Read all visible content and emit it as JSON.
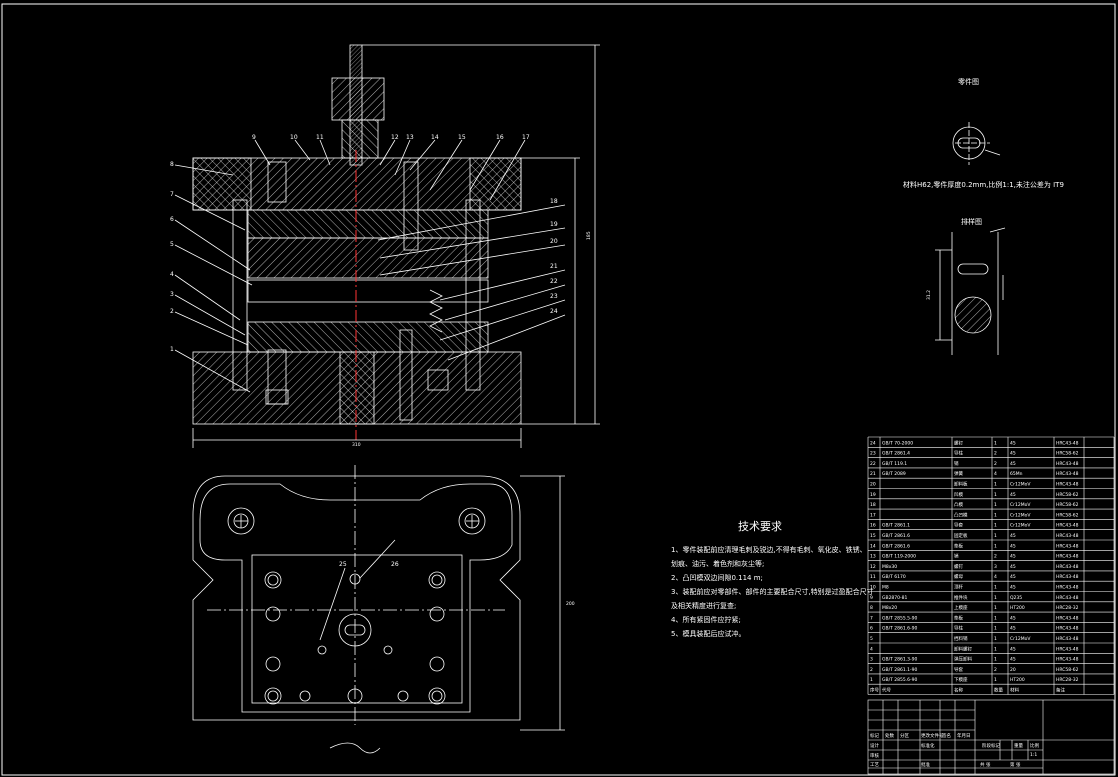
{
  "drawing": {
    "section_view": {
      "part_numbers_left": [
        "8",
        "7",
        "6",
        "5",
        "4",
        "3",
        "2",
        "1"
      ],
      "part_numbers_top": [
        "9",
        "10",
        "11",
        "12",
        "13",
        "14",
        "15",
        "16",
        "17"
      ],
      "part_numbers_right": [
        "18",
        "19",
        "20",
        "21",
        "22",
        "23",
        "24"
      ],
      "height_dim": "185",
      "width_dim": "310"
    },
    "plan_view": {
      "labels": [
        "25",
        "26"
      ],
      "height_dim": "200"
    },
    "workpiece": {
      "title": "零件图",
      "note": "材料H62,零件厚度0.2mm,比例1:1,未注公差为 IT9"
    },
    "strip": {
      "title": "排样图",
      "dim": "31.2"
    },
    "tech_req": {
      "title": "技术要求",
      "lines": [
        "1、零件装配前应清理毛刺及锐边,不得有毛刺、氧化皮、铁锈、",
        "   划痕、油污、着色剂和灰尘等;",
        "2、凸凹模双边间隙0.114 m;",
        "3、装配前应对零部件、部件的主要配合尺寸,特别是过盈配合尺寸",
        "   及相关精度进行复查;",
        "4、所有紧固件应拧紧;",
        "5、模具装配后应试冲。"
      ]
    },
    "bom": [
      {
        "no": "24",
        "code": "GB/T 70-2000",
        "name": "螺钉",
        "qty": "1",
        "mat": "45",
        "note": "HRC43-48"
      },
      {
        "no": "23",
        "code": "GB/T 2861.4",
        "name": "导柱",
        "qty": "2",
        "mat": "45",
        "note": "HRC58-62"
      },
      {
        "no": "22",
        "code": "GB/T 119.1",
        "name": "销",
        "qty": "2",
        "mat": "45",
        "note": "HRC43-48"
      },
      {
        "no": "21",
        "code": "GB/T 2089",
        "name": "弹簧",
        "qty": "4",
        "mat": "65Mn",
        "note": "HRC43-48"
      },
      {
        "no": "20",
        "code": "",
        "name": "卸料板",
        "qty": "1",
        "mat": "Cr12MoV",
        "note": "HRC43-48"
      },
      {
        "no": "19",
        "code": "",
        "name": "凹模",
        "qty": "1",
        "mat": "45",
        "note": "HRC58-62"
      },
      {
        "no": "18",
        "code": "",
        "name": "凸模",
        "qty": "1",
        "mat": "Cr12MoV",
        "note": "HRC58-62"
      },
      {
        "no": "17",
        "code": "",
        "name": "凸凹模",
        "qty": "1",
        "mat": "Cr12MoV",
        "note": "HRC58-62"
      },
      {
        "no": "16",
        "code": "GB/T 2861.1",
        "name": "导套",
        "qty": "1",
        "mat": "Cr12MoV",
        "note": "HRC43-48"
      },
      {
        "no": "15",
        "code": "GB/T 2861.6",
        "name": "固定板",
        "qty": "1",
        "mat": "45",
        "note": "HRC43-48"
      },
      {
        "no": "14",
        "code": "GB/T 2861.6",
        "name": "垫板",
        "qty": "1",
        "mat": "45",
        "note": "HRC43-48"
      },
      {
        "no": "13",
        "code": "GB/T 119-2000",
        "name": "销",
        "qty": "2",
        "mat": "45",
        "note": "HRC43-48"
      },
      {
        "no": "12",
        "code": "M8x30",
        "name": "螺钉",
        "qty": "3",
        "mat": "45",
        "note": "HRC43-48"
      },
      {
        "no": "11",
        "code": "GB/T 6170",
        "name": "螺母",
        "qty": "4",
        "mat": "45",
        "note": "HRC43-48"
      },
      {
        "no": "10",
        "code": "M8",
        "name": "顶杆",
        "qty": "1",
        "mat": "45",
        "note": "HRC43-48"
      },
      {
        "no": "9",
        "code": "GB2870-81",
        "name": "推件块",
        "qty": "1",
        "mat": "Q235",
        "note": "HRC43-48"
      },
      {
        "no": "8",
        "code": "M8x20",
        "name": "上模座",
        "qty": "1",
        "mat": "HT200",
        "note": "HRC28-32"
      },
      {
        "no": "7",
        "code": "GB/T 2855.5-90",
        "name": "垫板",
        "qty": "1",
        "mat": "45",
        "note": "HRC43-48"
      },
      {
        "no": "6",
        "code": "GB/T 2861.6-90",
        "name": "导柱",
        "qty": "1",
        "mat": "45",
        "note": "HRC43-48"
      },
      {
        "no": "5",
        "code": "",
        "name": "挡料销",
        "qty": "1",
        "mat": "Cr12MoV",
        "note": "HRC43-48"
      },
      {
        "no": "4",
        "code": "",
        "name": "卸料螺钉",
        "qty": "1",
        "mat": "45",
        "note": "HRC43-48"
      },
      {
        "no": "3",
        "code": "GB/T 2861.3-90",
        "name": "弹压卸料",
        "qty": "1",
        "mat": "45",
        "note": "HRC43-48"
      },
      {
        "no": "2",
        "code": "GB/T 2861.1-90",
        "name": "导套",
        "qty": "2",
        "mat": "20",
        "note": "HRC58-62"
      },
      {
        "no": "1",
        "code": "GB/T 2855.6-90",
        "name": "下模座",
        "qty": "1",
        "mat": "HT200",
        "note": "HRC28-32"
      }
    ],
    "bom_header": {
      "no": "序号",
      "code": "代号",
      "name": "名称",
      "qty": "数量",
      "mat": "材料",
      "note": "备注"
    },
    "title_block": {
      "cells": [
        "标记",
        "处数",
        "分区",
        "更改文件号",
        "签名",
        "年月日",
        "设计",
        "标准化",
        "阶段标记",
        "重量",
        "比例",
        "审核",
        "工艺",
        "批准",
        "共 张",
        "第 张",
        "1:1"
      ]
    }
  }
}
